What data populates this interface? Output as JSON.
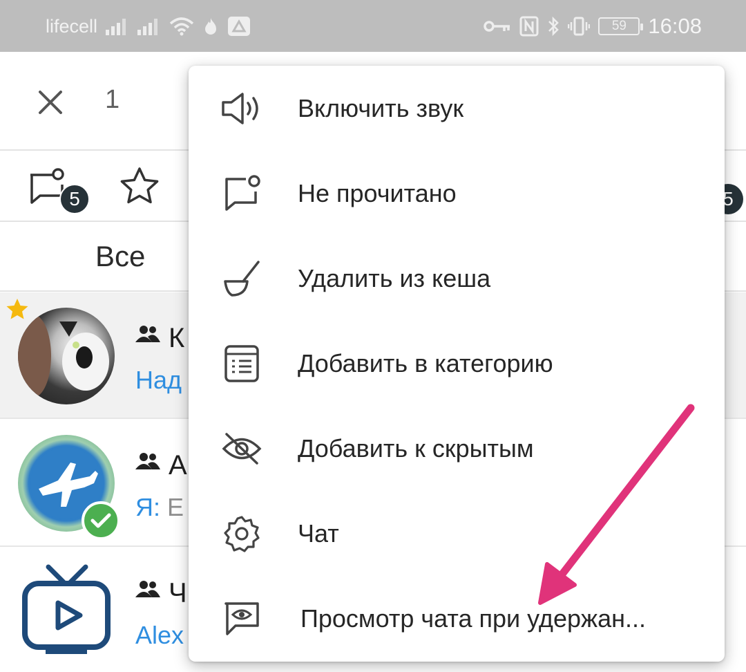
{
  "status_bar": {
    "carrier": "lifecell",
    "battery": "59",
    "time": "16:08"
  },
  "app_bar": {
    "selected_count": "1"
  },
  "filters": {
    "unread_badge": "5",
    "right_badge": "5"
  },
  "tabs": [
    {
      "label": "Все"
    }
  ],
  "chats": [
    {
      "title": "К",
      "subtitle": "Над"
    },
    {
      "title": "А",
      "subtitle_prefix": "Я:",
      "subtitle": "Е"
    },
    {
      "title": "Ч",
      "subtitle": "Alex"
    }
  ],
  "menu": {
    "items": [
      {
        "label": "Включить звук",
        "icon": "speaker-icon"
      },
      {
        "label": "Не прочитано",
        "icon": "unread-chat-icon"
      },
      {
        "label": "Удалить из кеша",
        "icon": "broom-icon"
      },
      {
        "label": "Добавить в категорию",
        "icon": "list-icon"
      },
      {
        "label": "Добавить к скрытым",
        "icon": "eye-off-icon"
      },
      {
        "label": "Чат",
        "icon": "gear-icon"
      },
      {
        "label": "Просмотр чата при удержан...",
        "icon": "chat-preview-icon"
      }
    ]
  },
  "colors": {
    "status_bar": "#bdbdbd",
    "accent_blue": "#2f8ee0",
    "annotation_arrow": "#e0337a",
    "badge": "#263238",
    "verified": "#4caf50",
    "favorite_star": "#f5b90f"
  }
}
